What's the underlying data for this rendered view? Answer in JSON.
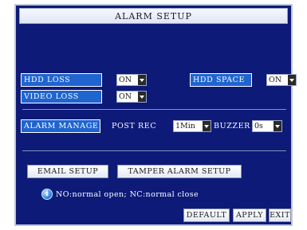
{
  "window": {
    "title": "ALARM SETUP"
  },
  "hdd_loss": {
    "label": "HDD LOSS",
    "value": "ON"
  },
  "hdd_space": {
    "label": "HDD SPACE",
    "value": "ON"
  },
  "video_loss": {
    "label": "VIDEO LOSS",
    "value": "ON"
  },
  "alarm_manage": {
    "label": "ALARM MANAGE"
  },
  "post_rec": {
    "label": "POST REC",
    "value": "1Min"
  },
  "buzzer": {
    "label": "BUZZER",
    "value": "0s"
  },
  "buttons": {
    "email_setup": "EMAIL SETUP",
    "tamper_alarm_setup": "TAMPER ALARM SETUP",
    "default": "DEFAULT",
    "apply": "APPLY",
    "exit": "EXIT"
  },
  "note": {
    "text": "NO:normal open;  NC:normal close"
  },
  "colors": {
    "panel": "#0d1a78",
    "highlight": "#1f64cf",
    "title_bg": "#f6f8ff"
  }
}
